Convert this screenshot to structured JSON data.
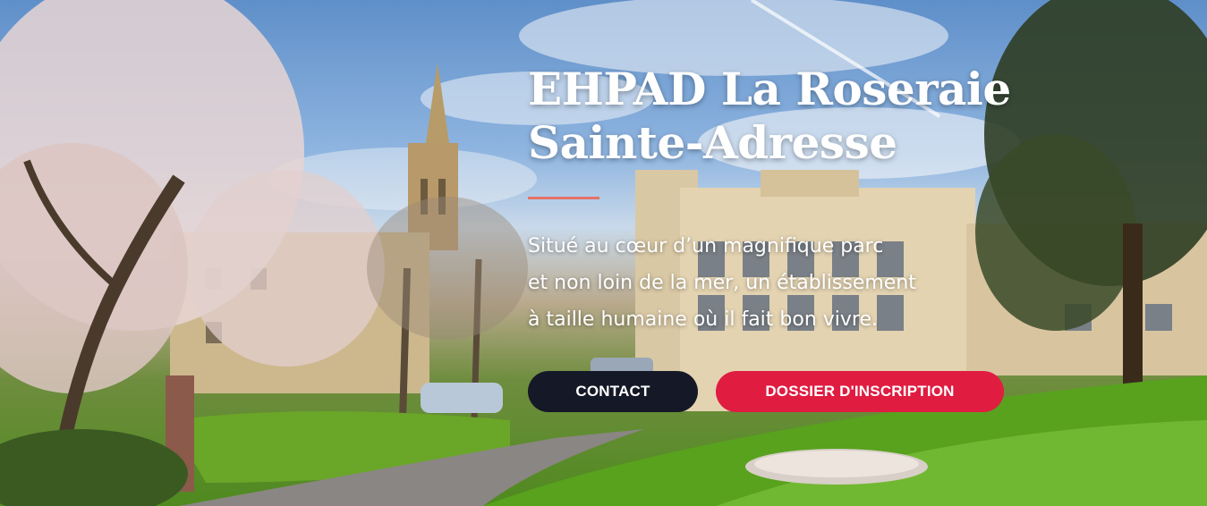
{
  "hero": {
    "title_line1": "EHPAD La Roseraie",
    "title_line2": "Sainte-Adresse",
    "text_line1": "Situé au cœur d’un magnifique parc",
    "text_line2": "et non loin de la mer, un établissement",
    "text_line3": "à taille humaine où il fait bon vivre.",
    "contact_label": "CONTACT",
    "dossier_label": "DOSSIER D'INSCRIPTION"
  },
  "colors": {
    "divider": "#e57368",
    "contact_button": "#151826",
    "dossier_button": "#e01c41",
    "text": "#ffffff"
  }
}
